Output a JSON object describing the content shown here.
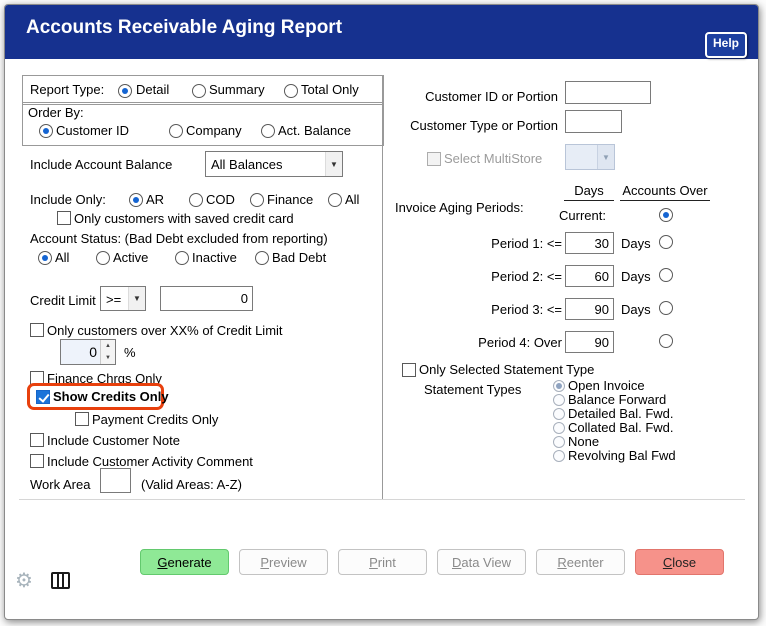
{
  "window": {
    "title": "Accounts Receivable Aging Report",
    "help": "Help"
  },
  "left": {
    "report_type": {
      "label": "Report Type:",
      "options": [
        {
          "label": "Detail",
          "selected": true
        },
        {
          "label": "Summary",
          "selected": false
        },
        {
          "label": "Total Only",
          "selected": false
        }
      ]
    },
    "order_by": {
      "label": "Order By:",
      "options": [
        {
          "label": "Customer ID",
          "selected": true
        },
        {
          "label": "Company",
          "selected": false
        },
        {
          "label": "Act. Balance",
          "selected": false
        }
      ]
    },
    "include_account_balance": {
      "label": "Include Account Balance",
      "value": "All Balances"
    },
    "include_only": {
      "label": "Include Only:",
      "options": [
        {
          "label": "AR",
          "selected": true
        },
        {
          "label": "COD",
          "selected": false
        },
        {
          "label": "Finance",
          "selected": false
        },
        {
          "label": "All",
          "selected": false
        }
      ]
    },
    "saved_credit_card": {
      "label": "Only customers with saved credit card",
      "checked": false
    },
    "account_status": {
      "label": "Account Status: (Bad Debt excluded from reporting)",
      "options": [
        {
          "label": "All",
          "selected": true
        },
        {
          "label": "Active",
          "selected": false
        },
        {
          "label": "Inactive",
          "selected": false
        },
        {
          "label": "Bad Debt",
          "selected": false
        }
      ]
    },
    "credit_limit": {
      "label": "Credit Limit",
      "operator": ">=",
      "value": "0"
    },
    "over_credit_limit": {
      "label": "Only customers over XX% of Credit Limit",
      "checked": false
    },
    "over_percent": {
      "value": "0",
      "suffix": "%"
    },
    "finance_chrgs_only": {
      "label": "Finance Chrgs Only",
      "checked": false
    },
    "show_credits_only": {
      "label": "Show Credits Only",
      "checked": true
    },
    "payment_credits_only": {
      "label": "Payment Credits Only",
      "checked": false
    },
    "include_customer_note": {
      "label": "Include Customer Note",
      "checked": false
    },
    "include_customer_activity": {
      "label": "Include Customer Activity Comment",
      "checked": false
    },
    "work_area": {
      "label": "Work Area",
      "value": "",
      "hint": "(Valid Areas: A-Z)"
    }
  },
  "right": {
    "customer_id": {
      "label": "Customer ID or Portion",
      "value": ""
    },
    "customer_type": {
      "label": "Customer Type or Portion",
      "value": ""
    },
    "multistore": {
      "label": "Select MultiStore",
      "checked": false
    },
    "aging": {
      "label": "Invoice Aging Periods:",
      "days_header": "Days",
      "accounts_header": "Accounts Over",
      "current_label": "Current:",
      "current_selected": true,
      "periods": [
        {
          "label": "Period 1: <=",
          "value": "30",
          "suffix": "Days",
          "selected": false
        },
        {
          "label": "Period 2: <=",
          "value": "60",
          "suffix": "Days",
          "selected": false
        },
        {
          "label": "Period 3: <=",
          "value": "90",
          "suffix": "Days",
          "selected": false
        },
        {
          "label": "Period 4: Over",
          "value": "90",
          "suffix": "",
          "selected": false
        }
      ]
    },
    "only_selected_statement": {
      "label": "Only Selected Statement Type",
      "checked": false
    },
    "statement_types": {
      "label": "Statement Types",
      "options": [
        {
          "label": "Open Invoice",
          "selected": true
        },
        {
          "label": "Balance Forward",
          "selected": false
        },
        {
          "label": "Detailed Bal. Fwd.",
          "selected": false
        },
        {
          "label": "Collated Bal. Fwd.",
          "selected": false
        },
        {
          "label": "None",
          "selected": false
        },
        {
          "label": "Revolving Bal Fwd",
          "selected": false
        }
      ]
    }
  },
  "buttons": {
    "generate": "Generate",
    "preview": "Preview",
    "print": "Print",
    "data_view": "Data View",
    "reenter": "Reenter",
    "close": "Close"
  },
  "colors": {
    "header_blue": "#16318f",
    "accent_blue": "#1464d2",
    "highlight_red": "#e8400d",
    "generate_green": "#8fe996",
    "close_red": "#f6928a"
  }
}
